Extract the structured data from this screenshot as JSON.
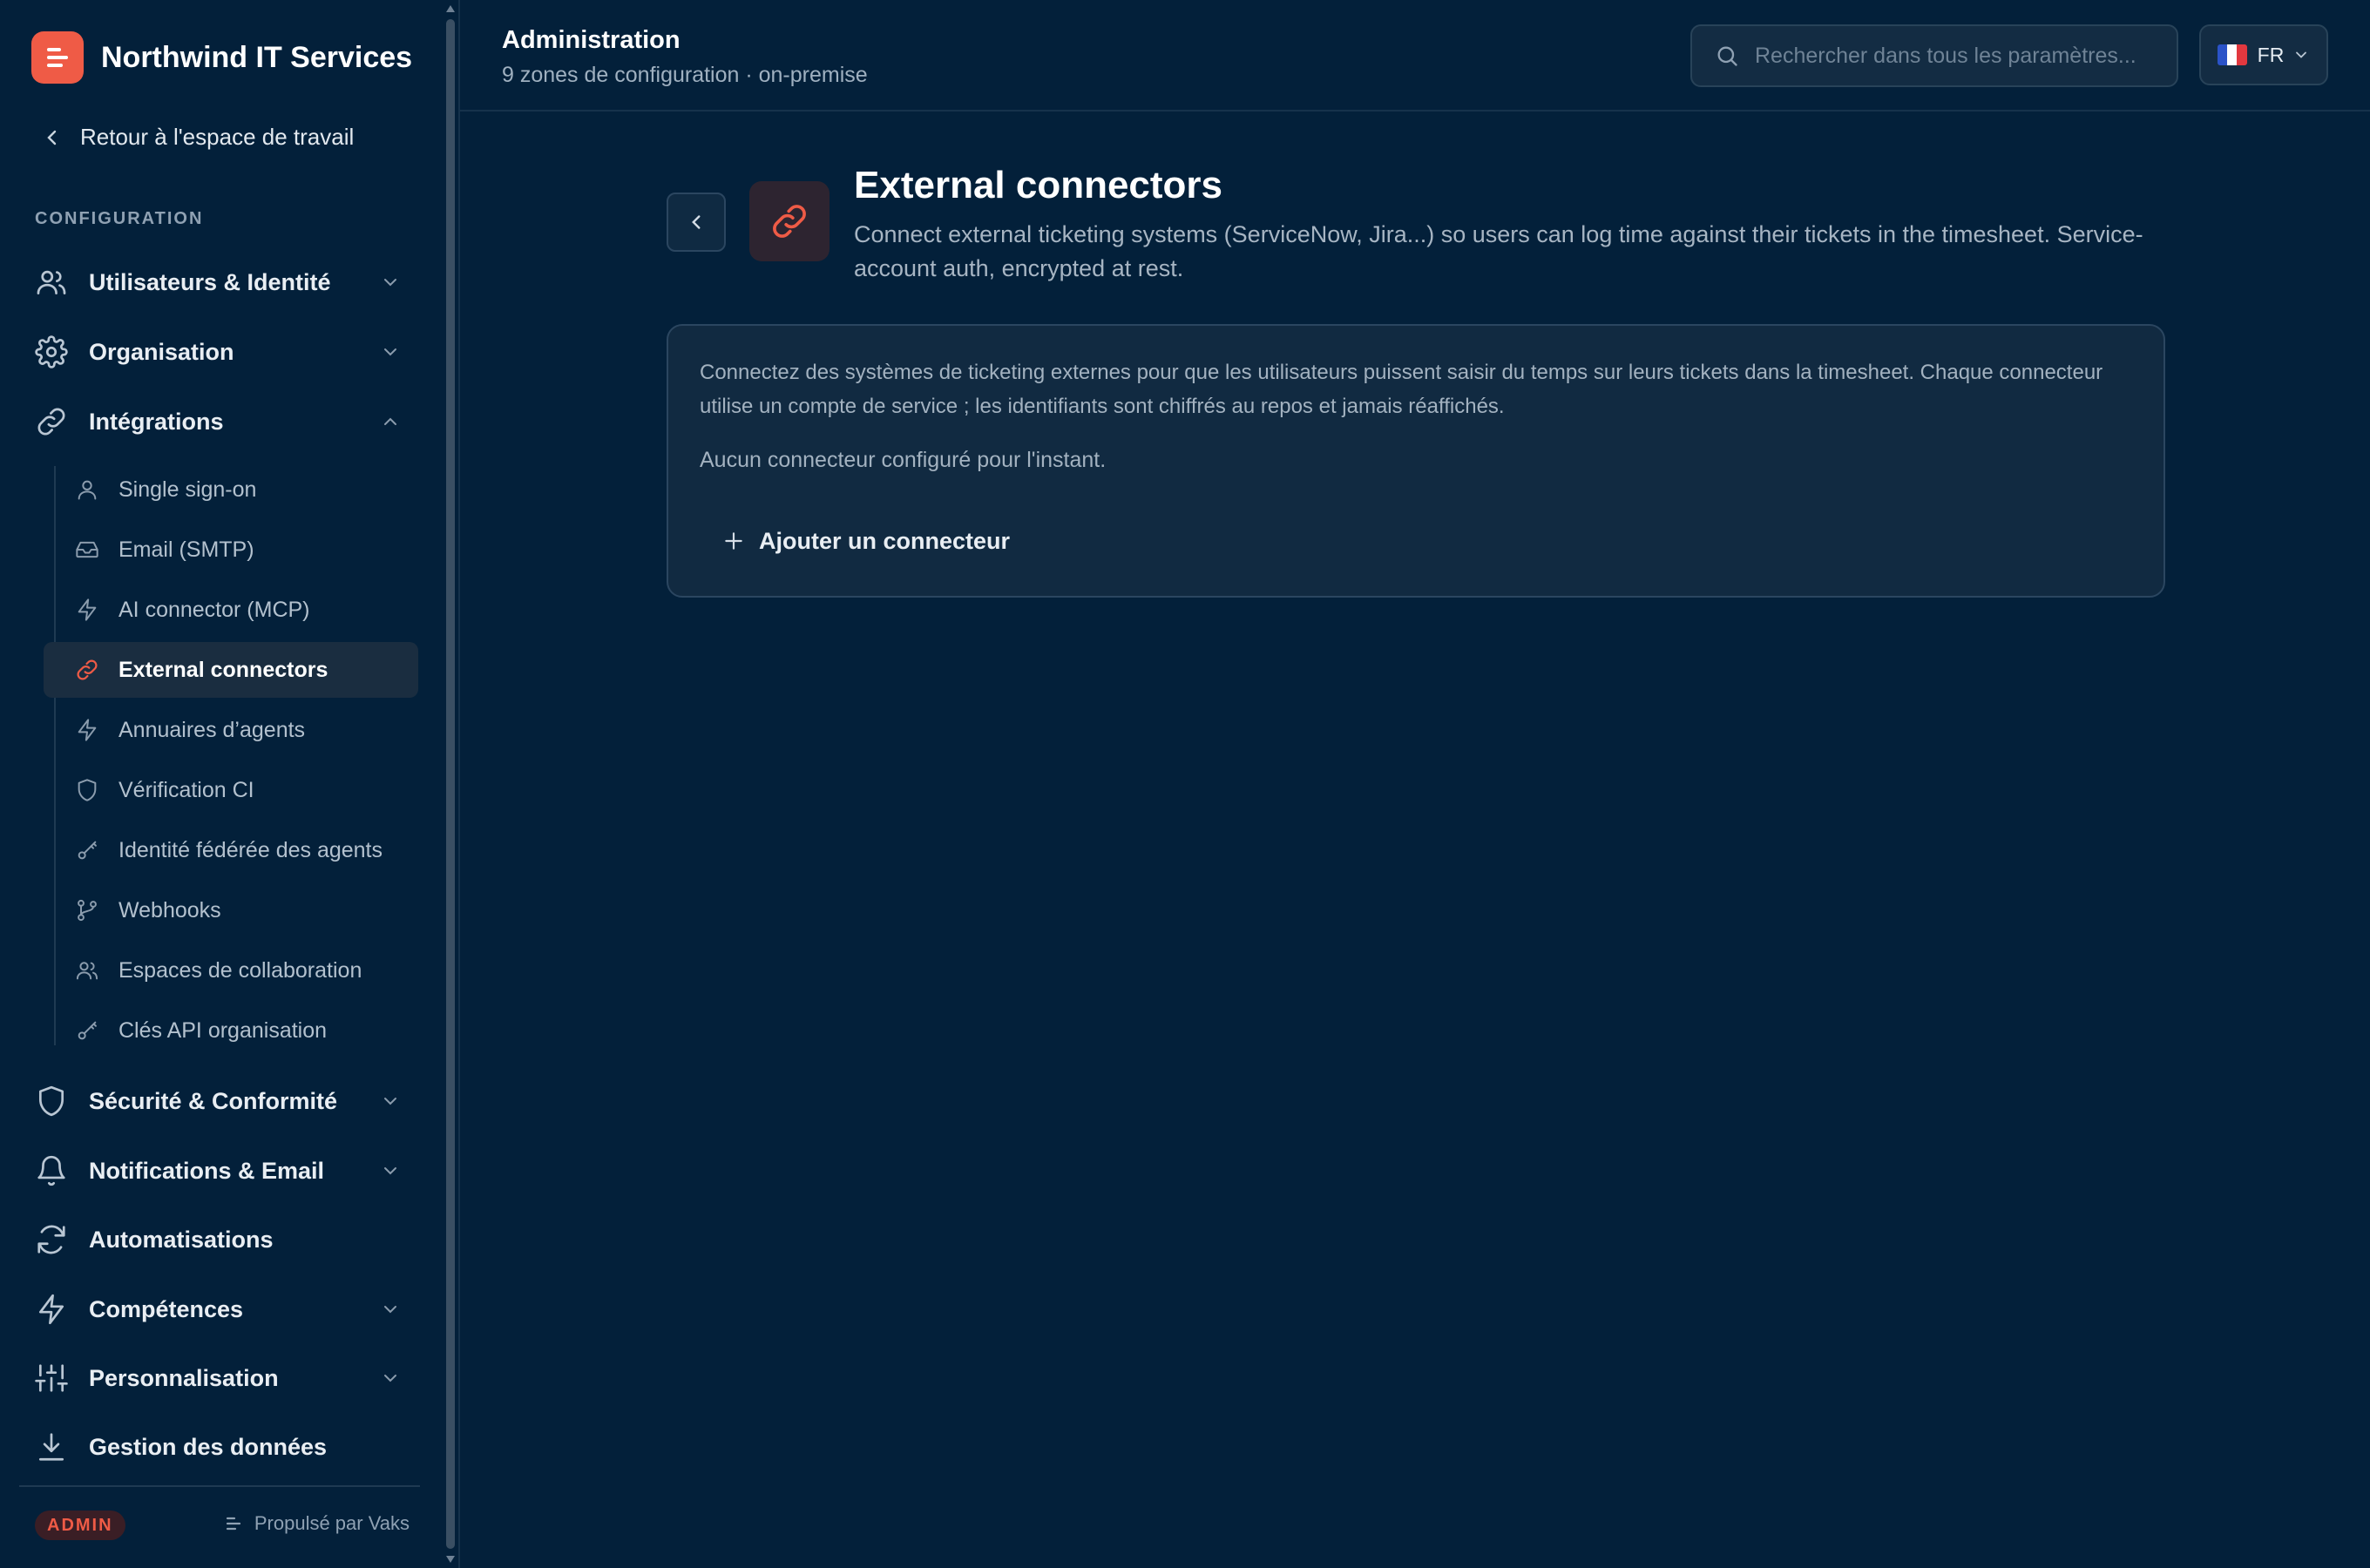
{
  "brand": {
    "name": "Northwind IT Services",
    "accent": "#ef5b46"
  },
  "sidebar": {
    "back_label": "Retour à l'espace de travail",
    "section_label": "CONFIGURATION",
    "groups": [
      {
        "label": "Utilisateurs & Identité",
        "icon": "users-icon",
        "expanded": false
      },
      {
        "label": "Organisation",
        "icon": "gear-icon",
        "expanded": false
      },
      {
        "label": "Intégrations",
        "icon": "link-icon",
        "expanded": true
      },
      {
        "label": "Sécurité & Conformité",
        "icon": "shield-icon",
        "expanded": false
      },
      {
        "label": "Notifications & Email",
        "icon": "bell-icon",
        "expanded": false
      },
      {
        "label": "Automatisations",
        "icon": "refresh-icon"
      },
      {
        "label": "Compétences",
        "icon": "bolt-icon",
        "expanded": false
      },
      {
        "label": "Personnalisation",
        "icon": "sliders-icon",
        "expanded": false
      },
      {
        "label": "Gestion des données",
        "icon": "download-icon"
      }
    ],
    "integrations": [
      {
        "label": "Single sign-on",
        "icon": "user-icon"
      },
      {
        "label": "Email (SMTP)",
        "icon": "inbox-icon"
      },
      {
        "label": "AI connector (MCP)",
        "icon": "bolt-icon"
      },
      {
        "label": "External connectors",
        "icon": "link-icon",
        "active": true
      },
      {
        "label": "Annuaires d’agents",
        "icon": "bolt-icon"
      },
      {
        "label": "Vérification CI",
        "icon": "shield-icon"
      },
      {
        "label": "Identité fédérée des agents",
        "icon": "key-icon"
      },
      {
        "label": "Webhooks",
        "icon": "git-branch-icon"
      },
      {
        "label": "Espaces de collaboration",
        "icon": "users-icon"
      },
      {
        "label": "Clés API organisation",
        "icon": "key-icon"
      }
    ],
    "footer": {
      "badge": "ADMIN",
      "powered_by": "Propulsé par Vaks"
    }
  },
  "header": {
    "title": "Administration",
    "subtitle": "9 zones de configuration · on-premise",
    "search_placeholder": "Rechercher dans tous les paramètres...",
    "language": "FR"
  },
  "page": {
    "title": "External connectors",
    "description": "Connect external ticketing systems (ServiceNow, Jira...) so users can log time against their tickets in the timesheet. Service-account auth, encrypted at rest.",
    "card": {
      "intro": "Connectez des systèmes de ticketing externes pour que les utilisateurs puissent saisir du temps sur leurs tickets dans la timesheet. Chaque connecteur utilise un compte de service ; les identifiants sont chiffrés au repos et jamais réaffichés.",
      "empty": "Aucun connecteur configuré pour l'instant.",
      "add_label": "Ajouter un connecteur"
    }
  },
  "colors": {
    "background": "#03203a",
    "card": "#112a41",
    "active_item": "#1a2d40"
  }
}
